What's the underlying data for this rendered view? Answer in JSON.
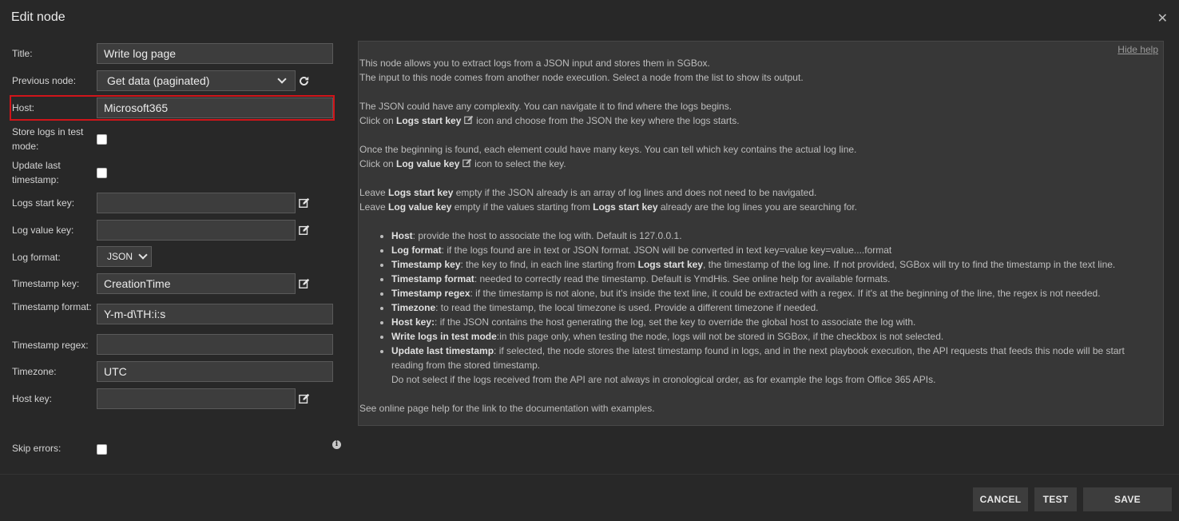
{
  "dialog": {
    "title": "Edit node",
    "close_glyph": "✕"
  },
  "form": {
    "title_label": "Title:",
    "title_value": "Write log page",
    "previous_node_label": "Previous node:",
    "previous_node_value": "Get data (paginated)",
    "host_label": "Host:",
    "host_value": "Microsoft365",
    "store_logs_label": "Store logs in test mode:",
    "update_last_label": "Update last timestamp:",
    "logs_start_key_label": "Logs start key:",
    "logs_start_key_value": "",
    "log_value_key_label": "Log value key:",
    "log_value_key_value": "",
    "log_format_label": "Log format:",
    "log_format_value": "JSON",
    "timestamp_key_label": "Timestamp key:",
    "timestamp_key_value": "CreationTime",
    "timestamp_format_label": "Timestamp format:",
    "timestamp_format_value": "Y-m-d\\TH:i:s",
    "timestamp_regex_label": "Timestamp regex:",
    "timestamp_regex_value": "",
    "timezone_label": "Timezone:",
    "timezone_value": "UTC",
    "host_key_label": "Host key:",
    "host_key_value": "",
    "skip_errors_label": "Skip errors:"
  },
  "help": {
    "hide_link": "Hide help",
    "p1a": "This node allows you to extract logs from a JSON input and stores them in SGBox.",
    "p1b": "The input to this node comes from another node execution. Select a node from the list to show its output.",
    "p2a": "The JSON could have any complexity. You can navigate it to find where the logs begins.",
    "p2b_pre": "Click on ",
    "p2b_bold": "Logs start key",
    "p2b_post": " icon and choose from the JSON the key where the logs starts.",
    "p3a": "Once the beginning is found, each element could have many keys. You can tell which key contains the actual log line.",
    "p3b_pre": "Click on ",
    "p3b_bold": "Log value key",
    "p3b_post": " icon to select the key.",
    "p4a_pre": "Leave ",
    "p4a_bold": "Logs start key",
    "p4a_post": " empty if the JSON already is an array of log lines and does not need to be navigated.",
    "p4b_pre": "Leave ",
    "p4b_bold": "Log value key",
    "p4b_mid": " empty if the values starting from ",
    "p4b_bold2": "Logs start key",
    "p4b_post": " already are the log lines you are searching for.",
    "items": [
      {
        "b": "Host",
        "t": ": provide the host to associate the log with. Default is 127.0.0.1."
      },
      {
        "b": "Log format",
        "t": ": if the logs found are in text or JSON format. JSON will be converted in text key=value key=value....format"
      },
      {
        "b": "Timestamp key",
        "t": ": the key to find, in each line starting from ",
        "b2": "Logs start key",
        "t2": ", the timestamp of the log line. If not provided, SGBox will try to find the timestamp in the text line."
      },
      {
        "b": "Timestamp format",
        "t": ": needed to correctly read the timestamp. Default is YmdHis. See online help for available formats."
      },
      {
        "b": "Timestamp regex",
        "t": ": if the timestamp is not alone, but it's inside the text line, it could be extracted with a regex. If it's at the beginning of the line, the regex is not needed."
      },
      {
        "b": "Timezone",
        "t": ": to read the timestamp, the local timezone is used. Provide a different timezone if needed."
      },
      {
        "b": "Host key:",
        "t": ": if the JSON contains the host generating the log, set the key to override the global host to associate the log with."
      },
      {
        "b": "Write logs in test mode",
        "t": ":in this page only, when testing the node, logs will not be stored in SGBox, if the checkbox is not selected."
      },
      {
        "b": "Update last timestamp",
        "t": ": if selected, the node stores the latest timestamp found in logs, and in the next playbook execution, the API requests that feeds this node will be start reading from the stored timestamp.",
        "t3": "Do not select if the logs received from the API are not always in cronological order, as for example the logs from Office 365 APIs."
      }
    ],
    "footer": "See online page help for the link to the documentation with examples."
  },
  "buttons": {
    "cancel": "CANCEL",
    "test": "TEST",
    "save": "SAVE"
  }
}
